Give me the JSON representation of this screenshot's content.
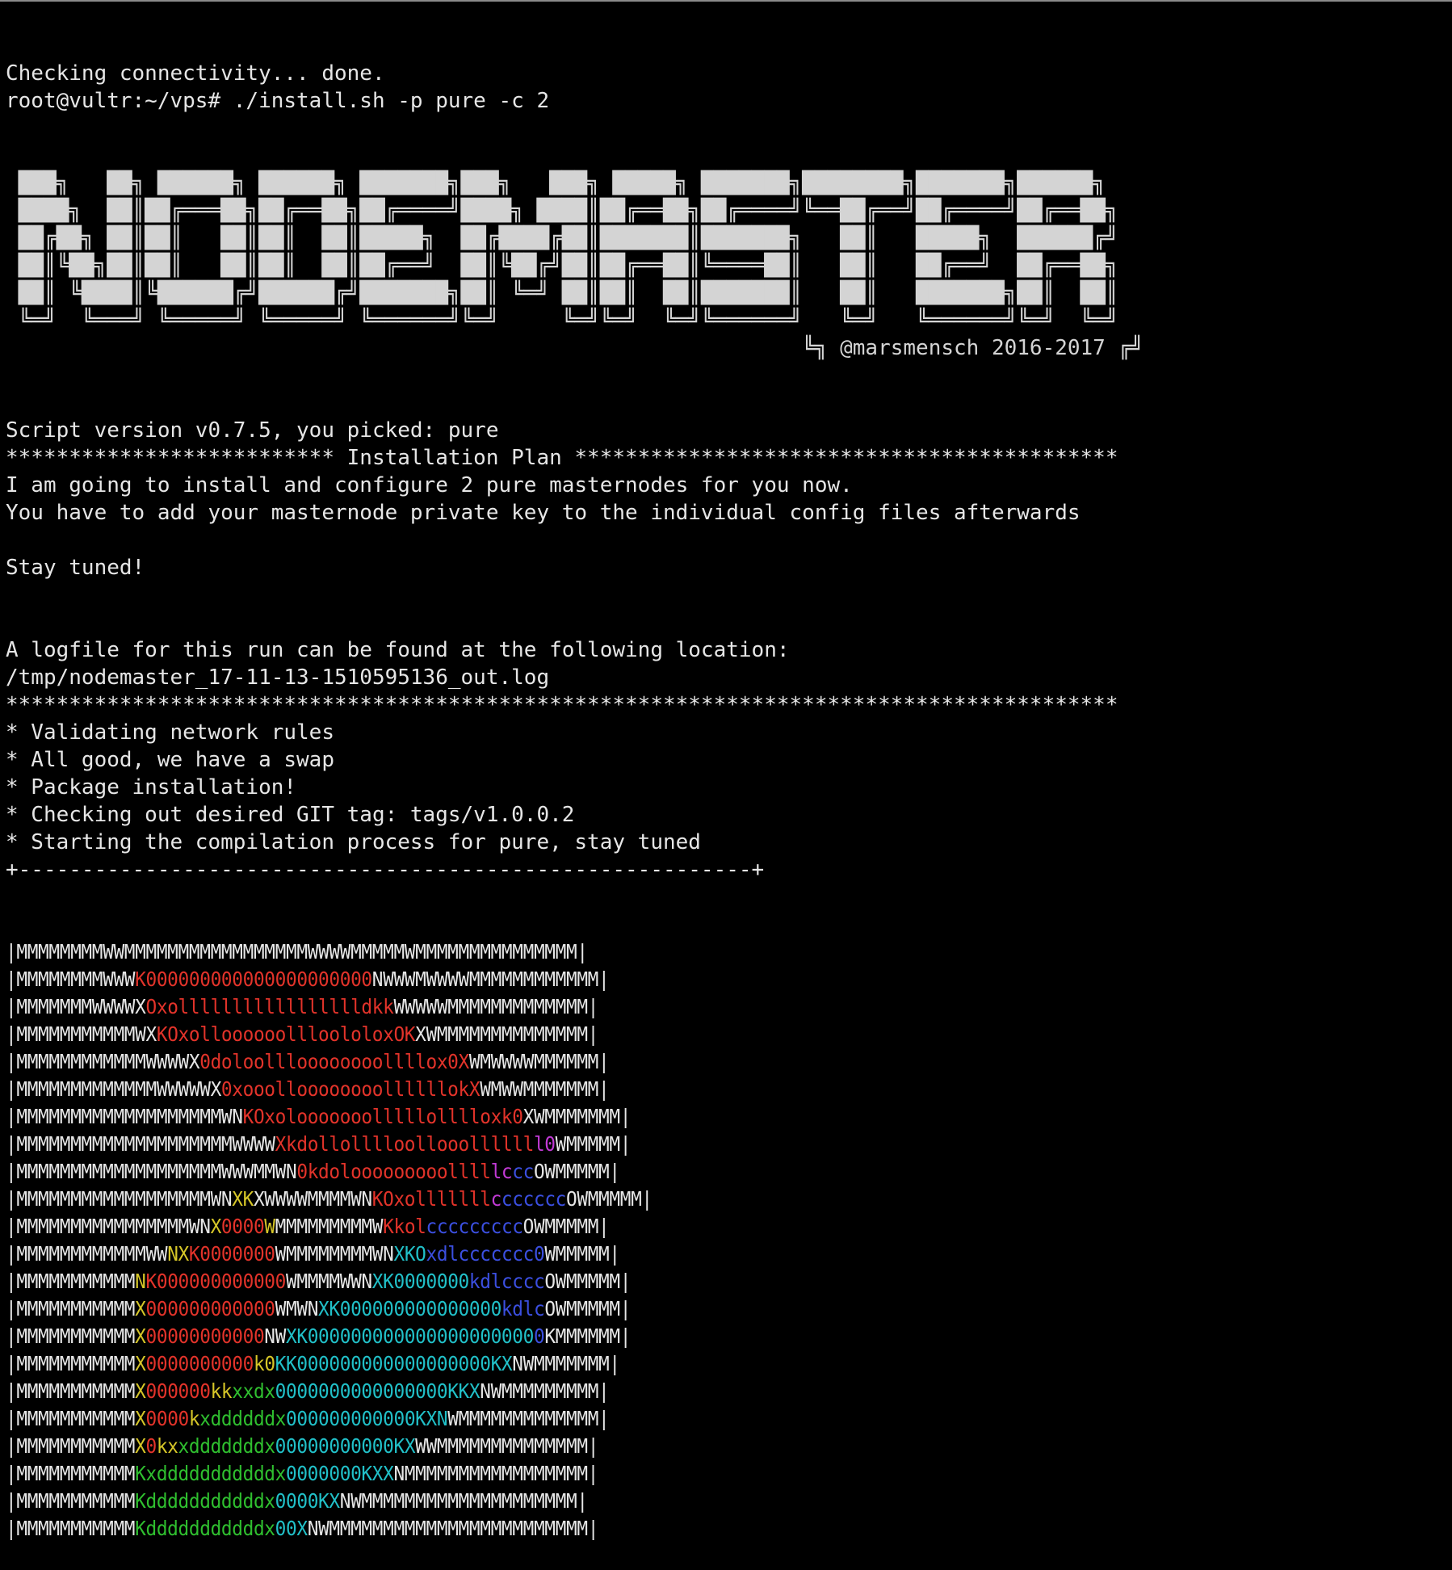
{
  "colors": {
    "background": "#000000",
    "W": "#e6e6e6",
    "R": "#e2332a",
    "Y": "#d6c628",
    "G": "#2fbf2f",
    "C": "#21c0c8",
    "B": "#3b4fe0",
    "M": "#c23ad6"
  },
  "terminal": {
    "pre_banner": [
      "Checking connectivity... done.",
      "root@vultr:~/vps# ./install.sh -p pure -c 2"
    ],
    "banner": [
      " ███╗   ██╗ ██████╗ ██████╗ ███████╗███╗   ███╗ █████╗ ███████╗████████╗███████╗██████╗",
      " ████╗  ██║██╔═══██╗██╔══██╗██╔════╝████╗ ████║██╔══██╗██╔════╝╚══██╔══╝██╔════╝██╔══██╗",
      " ██╔██╗ ██║██║   ██║██║  ██║█████╗  ██╔████╔██║███████║███████╗   ██║   █████╗  ██████╔╝",
      " ██║╚██╗██║██║   ██║██║  ██║██╔══╝  ██║╚██╔╝██║██╔══██║╚════██║   ██║   ██╔══╝  ██╔══██╗",
      " ██║ ╚████║╚██████╔╝██████╔╝███████╗██║ ╚═╝ ██║██║  ██║███████║   ██║   ███████╗██║  ██║",
      " ╚═╝  ╚═══╝ ╚═════╝ ╚═════╝ ╚══════╝╚═╝     ╚═╝╚═╝  ╚═╝╚══════╝   ╚═╝   ╚══════╝╚═╝  ╚═╝",
      "                                                               ╚╗ @marsmensch 2016-2017 ╔╝"
    ],
    "post_banner": [
      "Script version v0.7.5, you picked: pure",
      "************************** Installation Plan *******************************************",
      "I am going to install and configure 2 pure masternodes for you now.",
      "You have to add your masternode private key to the individual config files afterwards",
      "",
      "Stay tuned!",
      "",
      "",
      "A logfile for this run can be found at the following location:",
      "/tmp/nodemaster_17-11-13-1510595136_out.log",
      "****************************************************************************************",
      "* Validating network rules",
      "* All good, we have a swap",
      "* Package installation!",
      "* Checking out desired GIT tag: tags/v1.0.0.2",
      "* Starting the compilation process for pure, stay tuned",
      "+----------------------------------------------------------+"
    ],
    "art": [
      [
        [
          "W",
          "|MMMMMMMMWWMMMMMMMMMMMMMMMMMWWWWMMMMMWMMMMMMMMMMMMMMM|"
        ]
      ],
      [
        [
          "W",
          "|MMMMMMMMWWW"
        ],
        [
          "R",
          "K000000000000000000000"
        ],
        [
          "W",
          "NWWWMWWWWMMMMMMMMMMMM|"
        ]
      ],
      [
        [
          "W",
          "|MMMMMMMWWWWX"
        ],
        [
          "R",
          "Oxollllllllllllllllldkk"
        ],
        [
          "W",
          "WWWWWMMMMMMMMMMMMM|"
        ]
      ],
      [
        [
          "W",
          "|MMMMMMMMMMMWX"
        ],
        [
          "R",
          "KOxolloooooollloololoxOK"
        ],
        [
          "W",
          "XWMMMMMMMMMMMMMM|"
        ]
      ],
      [
        [
          "W",
          "|MMMMMMMMMMMMWWWWX"
        ],
        [
          "R",
          "0doloollloooooooollllox0X"
        ],
        [
          "W",
          "WMWWWWMMMMMM|"
        ]
      ],
      [
        [
          "W",
          "|MMMMMMMMMMMMMWWWWWX"
        ],
        [
          "R",
          "0xooolloooooooollllllokX"
        ],
        [
          "W",
          "WMWWMMMMMMM|"
        ]
      ],
      [
        [
          "W",
          "|MMMMMMMMMMMMMMMMMMMWN"
        ],
        [
          "R",
          "KOxolooooooolllllolllloxk0"
        ],
        [
          "W",
          "XWMMMMMMM|"
        ]
      ],
      [
        [
          "W",
          "|MMMMMMMMMMMMMMMMMMMMWWWW"
        ],
        [
          "R",
          "Xkdollolllloollooollllll"
        ],
        [
          "M",
          "l0"
        ],
        [
          "W",
          "WMMMMM|"
        ]
      ],
      [
        [
          "W",
          "|MMMMMMMMMMMMMMMMMMMWWWMMWN"
        ],
        [
          "R",
          "0kdolooooooooollll"
        ],
        [
          "M",
          "lc"
        ],
        [
          "B",
          "cc"
        ],
        [
          "W",
          "OWMMMMM|"
        ]
      ],
      [
        [
          "W",
          "|MMMMMMMMMMMMMMMMMMWN"
        ],
        [
          "Y",
          "XK"
        ],
        [
          "W",
          "XWWWWMMMMWN"
        ],
        [
          "R",
          "KOxolllllll"
        ],
        [
          "M",
          "c"
        ],
        [
          "B",
          "cccccc"
        ],
        [
          "W",
          "OWMMMMM|"
        ]
      ],
      [
        [
          "W",
          "|MMMMMMMMMMMMMMMMWN"
        ],
        [
          "Y",
          "X"
        ],
        [
          "R",
          "0000"
        ],
        [
          "Y",
          "W"
        ],
        [
          "W",
          "MMMMMMMMMW"
        ],
        [
          "R",
          "Kkol"
        ],
        [
          "B",
          "ccccccccc"
        ],
        [
          "W",
          "OWMMMMM|"
        ]
      ],
      [
        [
          "W",
          "|MMMMMMMMMMMMWW"
        ],
        [
          "Y",
          "NX"
        ],
        [
          "R",
          "K0000000"
        ],
        [
          "W",
          "WMMMMMMMMWN"
        ],
        [
          "C",
          "XKO"
        ],
        [
          "B",
          "xdlccccccc0"
        ],
        [
          "W",
          "WMMMMM|"
        ]
      ],
      [
        [
          "W",
          "|MMMMMMMMMMM"
        ],
        [
          "Y",
          "N"
        ],
        [
          "R",
          "K000000000000"
        ],
        [
          "W",
          "WMMMMWWN"
        ],
        [
          "C",
          "XK0000000"
        ],
        [
          "B",
          "kdlcccc"
        ],
        [
          "W",
          "OWMMMMM|"
        ]
      ],
      [
        [
          "W",
          "|MMMMMMMMMMM"
        ],
        [
          "Y",
          "X"
        ],
        [
          "R",
          "000000000000"
        ],
        [
          "W",
          "WMWN"
        ],
        [
          "C",
          "XK000000000000000"
        ],
        [
          "B",
          "kdlc"
        ],
        [
          "W",
          "OWMMMMM|"
        ]
      ],
      [
        [
          "W",
          "|MMMMMMMMMMM"
        ],
        [
          "Y",
          "X"
        ],
        [
          "R",
          "00000000000"
        ],
        [
          "W",
          "NW"
        ],
        [
          "C",
          "XK000000000000000000000"
        ],
        [
          "B",
          "0"
        ],
        [
          "W",
          "KMMMMMM|"
        ]
      ],
      [
        [
          "W",
          "|MMMMMMMMMMM"
        ],
        [
          "Y",
          "X"
        ],
        [
          "R",
          "0000000000"
        ],
        [
          "Y",
          "k0"
        ],
        [
          "C",
          "KK000000000000000000KX"
        ],
        [
          "W",
          "NWMMMMMMM|"
        ]
      ],
      [
        [
          "W",
          "|MMMMMMMMMMM"
        ],
        [
          "Y",
          "X"
        ],
        [
          "R",
          "000000"
        ],
        [
          "Y",
          "kk"
        ],
        [
          "G",
          "xxdx"
        ],
        [
          "C",
          "0000000000000000KKX"
        ],
        [
          "W",
          "NWMMMMMMMMM|"
        ]
      ],
      [
        [
          "W",
          "|MMMMMMMMMMM"
        ],
        [
          "Y",
          "X"
        ],
        [
          "R",
          "0000"
        ],
        [
          "Y",
          "k"
        ],
        [
          "G",
          "xddddddx"
        ],
        [
          "C",
          "000000000000KXN"
        ],
        [
          "W",
          "WMMMMMMMMMMMMM|"
        ]
      ],
      [
        [
          "W",
          "|MMMMMMMMMMM"
        ],
        [
          "Y",
          "X"
        ],
        [
          "R",
          "0"
        ],
        [
          "Y",
          "kx"
        ],
        [
          "G",
          "xdddddddx"
        ],
        [
          "C",
          "00000000000KX"
        ],
        [
          "W",
          "WWMMMMMMMMMMMMMM|"
        ]
      ],
      [
        [
          "W",
          "|MMMMMMMMMMM"
        ],
        [
          "G",
          "Kxdddddddddddx"
        ],
        [
          "C",
          "0000000KXX"
        ],
        [
          "W",
          "NMMMMMMMMMMMMMMMMM|"
        ]
      ],
      [
        [
          "W",
          "|MMMMMMMMMMM"
        ],
        [
          "G",
          "Kdddddddddddx"
        ],
        [
          "C",
          "0000KX"
        ],
        [
          "W",
          "NWMMMMMMMMMMMMMMMMMMMM|"
        ]
      ],
      [
        [
          "W",
          "|MMMMMMMMMMM"
        ],
        [
          "G",
          "Kdddddddddddx"
        ],
        [
          "C",
          "00X"
        ],
        [
          "W",
          "NWMMMMMMMMMMMMMMMMMMMMMMMM|"
        ]
      ]
    ]
  }
}
